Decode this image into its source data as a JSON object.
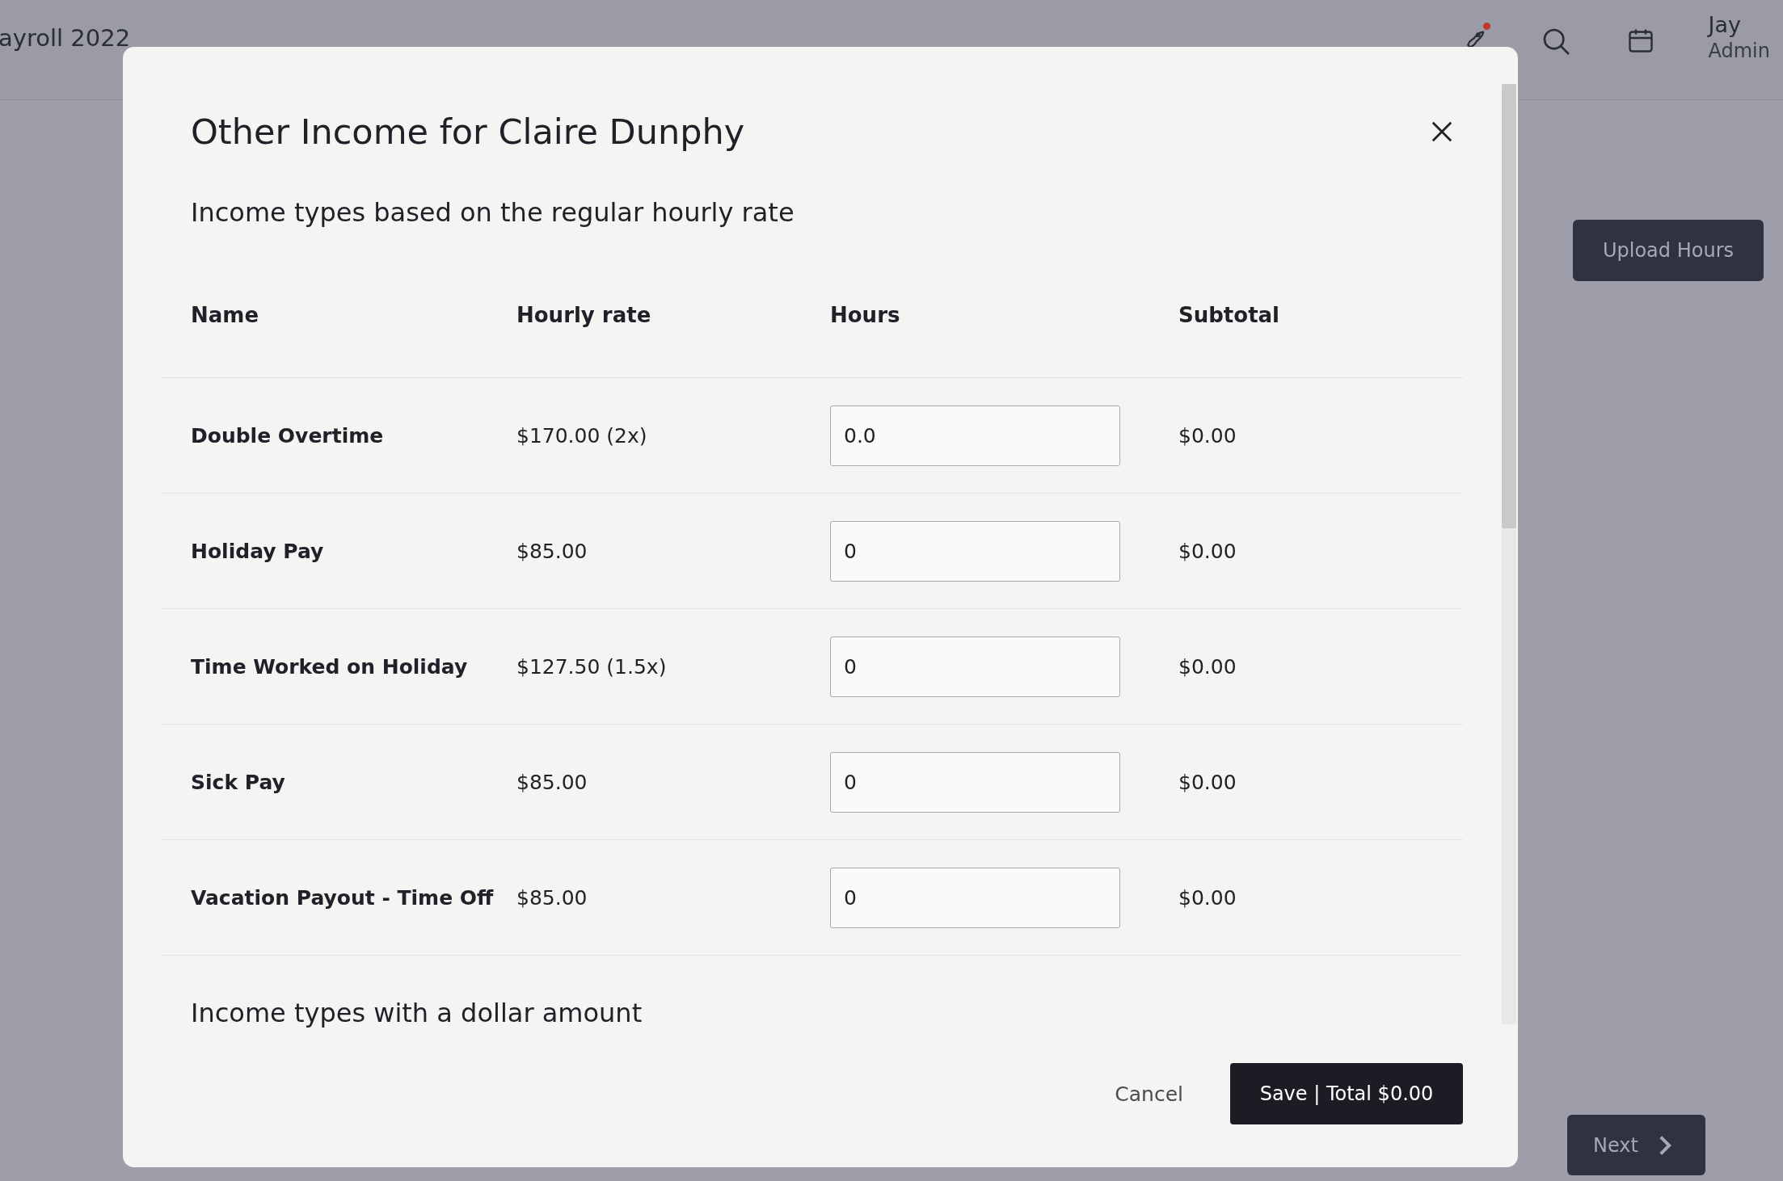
{
  "header": {
    "title": "ayroll 2022",
    "notification": true,
    "user": {
      "name": "Jay",
      "role": "Admin"
    }
  },
  "page": {
    "upload_button": "Upload Hours",
    "next_button": "Next"
  },
  "modal": {
    "title": "Other Income for Claire Dunphy",
    "sections": [
      {
        "heading": "Income types based on the regular hourly rate",
        "columns": [
          "Name",
          "Hourly rate",
          "Hours",
          "Subtotal"
        ],
        "rows": [
          {
            "name": "Double Overtime",
            "rate": "$170.00 (2x)",
            "hours": "0.0",
            "subtotal": "$0.00"
          },
          {
            "name": "Holiday Pay",
            "rate": "$85.00",
            "hours": "0",
            "subtotal": "$0.00"
          },
          {
            "name": "Time Worked on Holiday",
            "rate": "$127.50 (1.5x)",
            "hours": "0",
            "subtotal": "$0.00"
          },
          {
            "name": "Sick Pay",
            "rate": "$85.00",
            "hours": "0",
            "subtotal": "$0.00"
          },
          {
            "name": "Vacation Payout - Time Off",
            "rate": "$85.00",
            "hours": "0",
            "subtotal": "$0.00"
          }
        ]
      },
      {
        "heading": "Income types with a dollar amount"
      }
    ],
    "cancel_button": "Cancel",
    "save_button": "Save | Total $0.00"
  }
}
